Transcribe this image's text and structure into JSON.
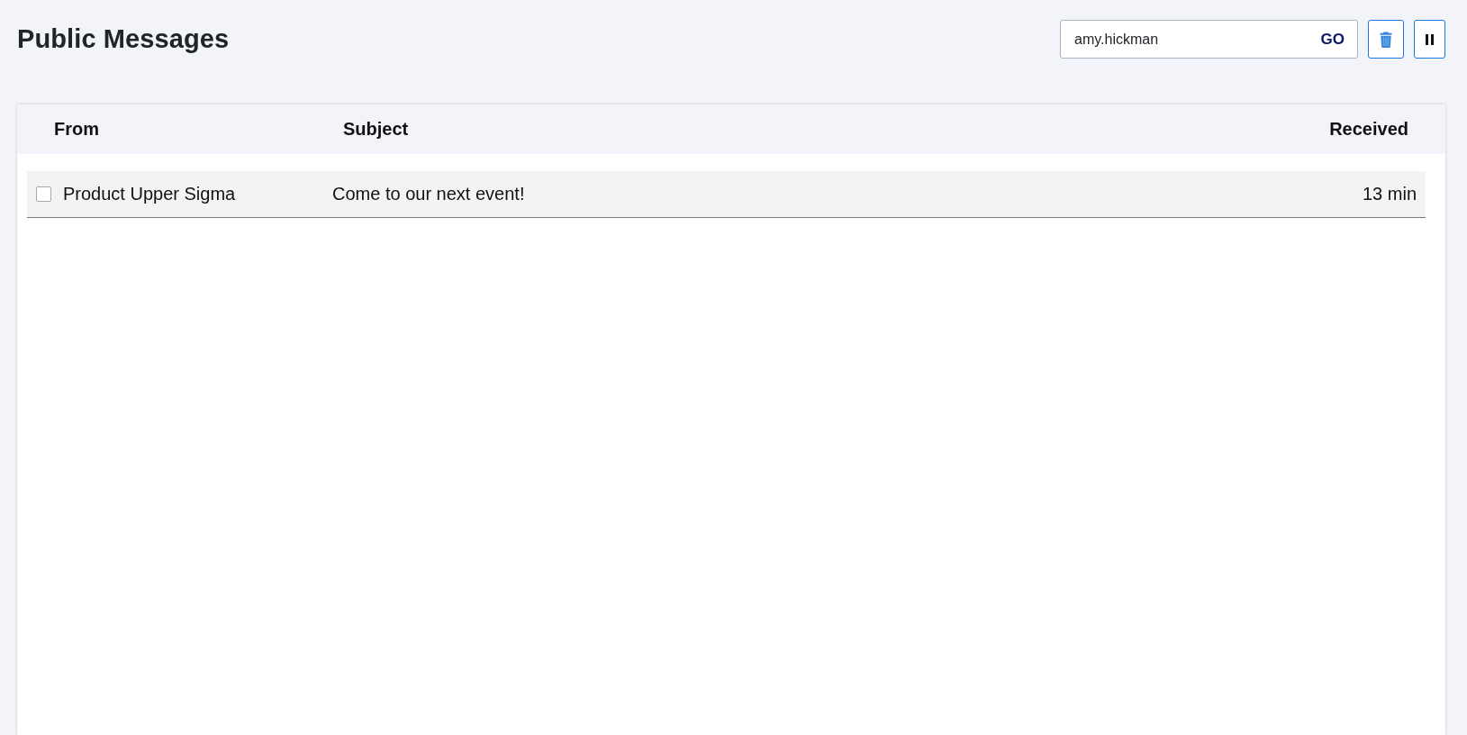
{
  "page": {
    "title": "Public Messages"
  },
  "toolbar": {
    "search": {
      "value": "amy.hickman",
      "button": "GO"
    }
  },
  "table": {
    "columns": [
      "From",
      "Subject",
      "Received"
    ],
    "rows": [
      {
        "checked": false,
        "from": "Product Upper Sigma",
        "subject": "Come to our next event!",
        "received": "13 min"
      }
    ]
  }
}
